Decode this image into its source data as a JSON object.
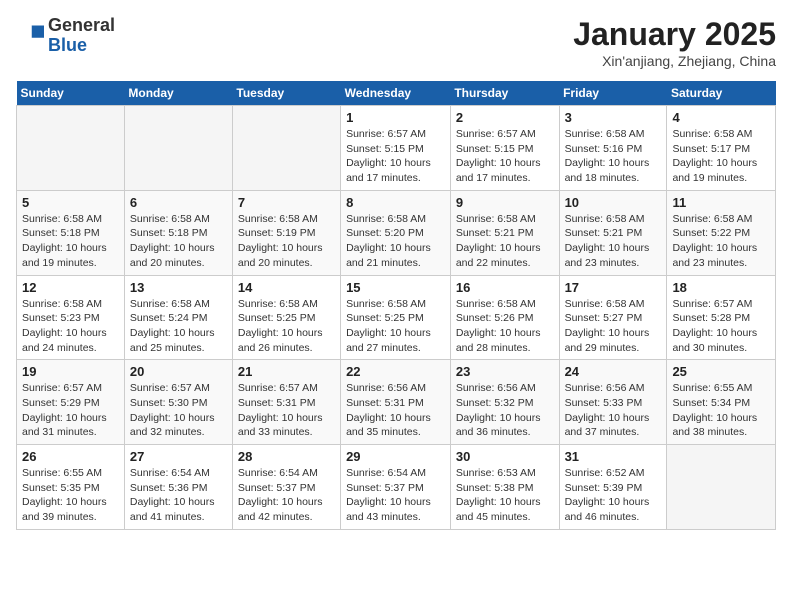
{
  "header": {
    "logo_general": "General",
    "logo_blue": "Blue",
    "title": "January 2025",
    "subtitle": "Xin'anjiang, Zhejiang, China"
  },
  "weekdays": [
    "Sunday",
    "Monday",
    "Tuesday",
    "Wednesday",
    "Thursday",
    "Friday",
    "Saturday"
  ],
  "weeks": [
    [
      {
        "day": "",
        "info": ""
      },
      {
        "day": "",
        "info": ""
      },
      {
        "day": "",
        "info": ""
      },
      {
        "day": "1",
        "info": "Sunrise: 6:57 AM\nSunset: 5:15 PM\nDaylight: 10 hours and 17 minutes."
      },
      {
        "day": "2",
        "info": "Sunrise: 6:57 AM\nSunset: 5:15 PM\nDaylight: 10 hours and 17 minutes."
      },
      {
        "day": "3",
        "info": "Sunrise: 6:58 AM\nSunset: 5:16 PM\nDaylight: 10 hours and 18 minutes."
      },
      {
        "day": "4",
        "info": "Sunrise: 6:58 AM\nSunset: 5:17 PM\nDaylight: 10 hours and 19 minutes."
      }
    ],
    [
      {
        "day": "5",
        "info": "Sunrise: 6:58 AM\nSunset: 5:18 PM\nDaylight: 10 hours and 19 minutes."
      },
      {
        "day": "6",
        "info": "Sunrise: 6:58 AM\nSunset: 5:18 PM\nDaylight: 10 hours and 20 minutes."
      },
      {
        "day": "7",
        "info": "Sunrise: 6:58 AM\nSunset: 5:19 PM\nDaylight: 10 hours and 20 minutes."
      },
      {
        "day": "8",
        "info": "Sunrise: 6:58 AM\nSunset: 5:20 PM\nDaylight: 10 hours and 21 minutes."
      },
      {
        "day": "9",
        "info": "Sunrise: 6:58 AM\nSunset: 5:21 PM\nDaylight: 10 hours and 22 minutes."
      },
      {
        "day": "10",
        "info": "Sunrise: 6:58 AM\nSunset: 5:21 PM\nDaylight: 10 hours and 23 minutes."
      },
      {
        "day": "11",
        "info": "Sunrise: 6:58 AM\nSunset: 5:22 PM\nDaylight: 10 hours and 23 minutes."
      }
    ],
    [
      {
        "day": "12",
        "info": "Sunrise: 6:58 AM\nSunset: 5:23 PM\nDaylight: 10 hours and 24 minutes."
      },
      {
        "day": "13",
        "info": "Sunrise: 6:58 AM\nSunset: 5:24 PM\nDaylight: 10 hours and 25 minutes."
      },
      {
        "day": "14",
        "info": "Sunrise: 6:58 AM\nSunset: 5:25 PM\nDaylight: 10 hours and 26 minutes."
      },
      {
        "day": "15",
        "info": "Sunrise: 6:58 AM\nSunset: 5:25 PM\nDaylight: 10 hours and 27 minutes."
      },
      {
        "day": "16",
        "info": "Sunrise: 6:58 AM\nSunset: 5:26 PM\nDaylight: 10 hours and 28 minutes."
      },
      {
        "day": "17",
        "info": "Sunrise: 6:58 AM\nSunset: 5:27 PM\nDaylight: 10 hours and 29 minutes."
      },
      {
        "day": "18",
        "info": "Sunrise: 6:57 AM\nSunset: 5:28 PM\nDaylight: 10 hours and 30 minutes."
      }
    ],
    [
      {
        "day": "19",
        "info": "Sunrise: 6:57 AM\nSunset: 5:29 PM\nDaylight: 10 hours and 31 minutes."
      },
      {
        "day": "20",
        "info": "Sunrise: 6:57 AM\nSunset: 5:30 PM\nDaylight: 10 hours and 32 minutes."
      },
      {
        "day": "21",
        "info": "Sunrise: 6:57 AM\nSunset: 5:31 PM\nDaylight: 10 hours and 33 minutes."
      },
      {
        "day": "22",
        "info": "Sunrise: 6:56 AM\nSunset: 5:31 PM\nDaylight: 10 hours and 35 minutes."
      },
      {
        "day": "23",
        "info": "Sunrise: 6:56 AM\nSunset: 5:32 PM\nDaylight: 10 hours and 36 minutes."
      },
      {
        "day": "24",
        "info": "Sunrise: 6:56 AM\nSunset: 5:33 PM\nDaylight: 10 hours and 37 minutes."
      },
      {
        "day": "25",
        "info": "Sunrise: 6:55 AM\nSunset: 5:34 PM\nDaylight: 10 hours and 38 minutes."
      }
    ],
    [
      {
        "day": "26",
        "info": "Sunrise: 6:55 AM\nSunset: 5:35 PM\nDaylight: 10 hours and 39 minutes."
      },
      {
        "day": "27",
        "info": "Sunrise: 6:54 AM\nSunset: 5:36 PM\nDaylight: 10 hours and 41 minutes."
      },
      {
        "day": "28",
        "info": "Sunrise: 6:54 AM\nSunset: 5:37 PM\nDaylight: 10 hours and 42 minutes."
      },
      {
        "day": "29",
        "info": "Sunrise: 6:54 AM\nSunset: 5:37 PM\nDaylight: 10 hours and 43 minutes."
      },
      {
        "day": "30",
        "info": "Sunrise: 6:53 AM\nSunset: 5:38 PM\nDaylight: 10 hours and 45 minutes."
      },
      {
        "day": "31",
        "info": "Sunrise: 6:52 AM\nSunset: 5:39 PM\nDaylight: 10 hours and 46 minutes."
      },
      {
        "day": "",
        "info": ""
      }
    ]
  ]
}
